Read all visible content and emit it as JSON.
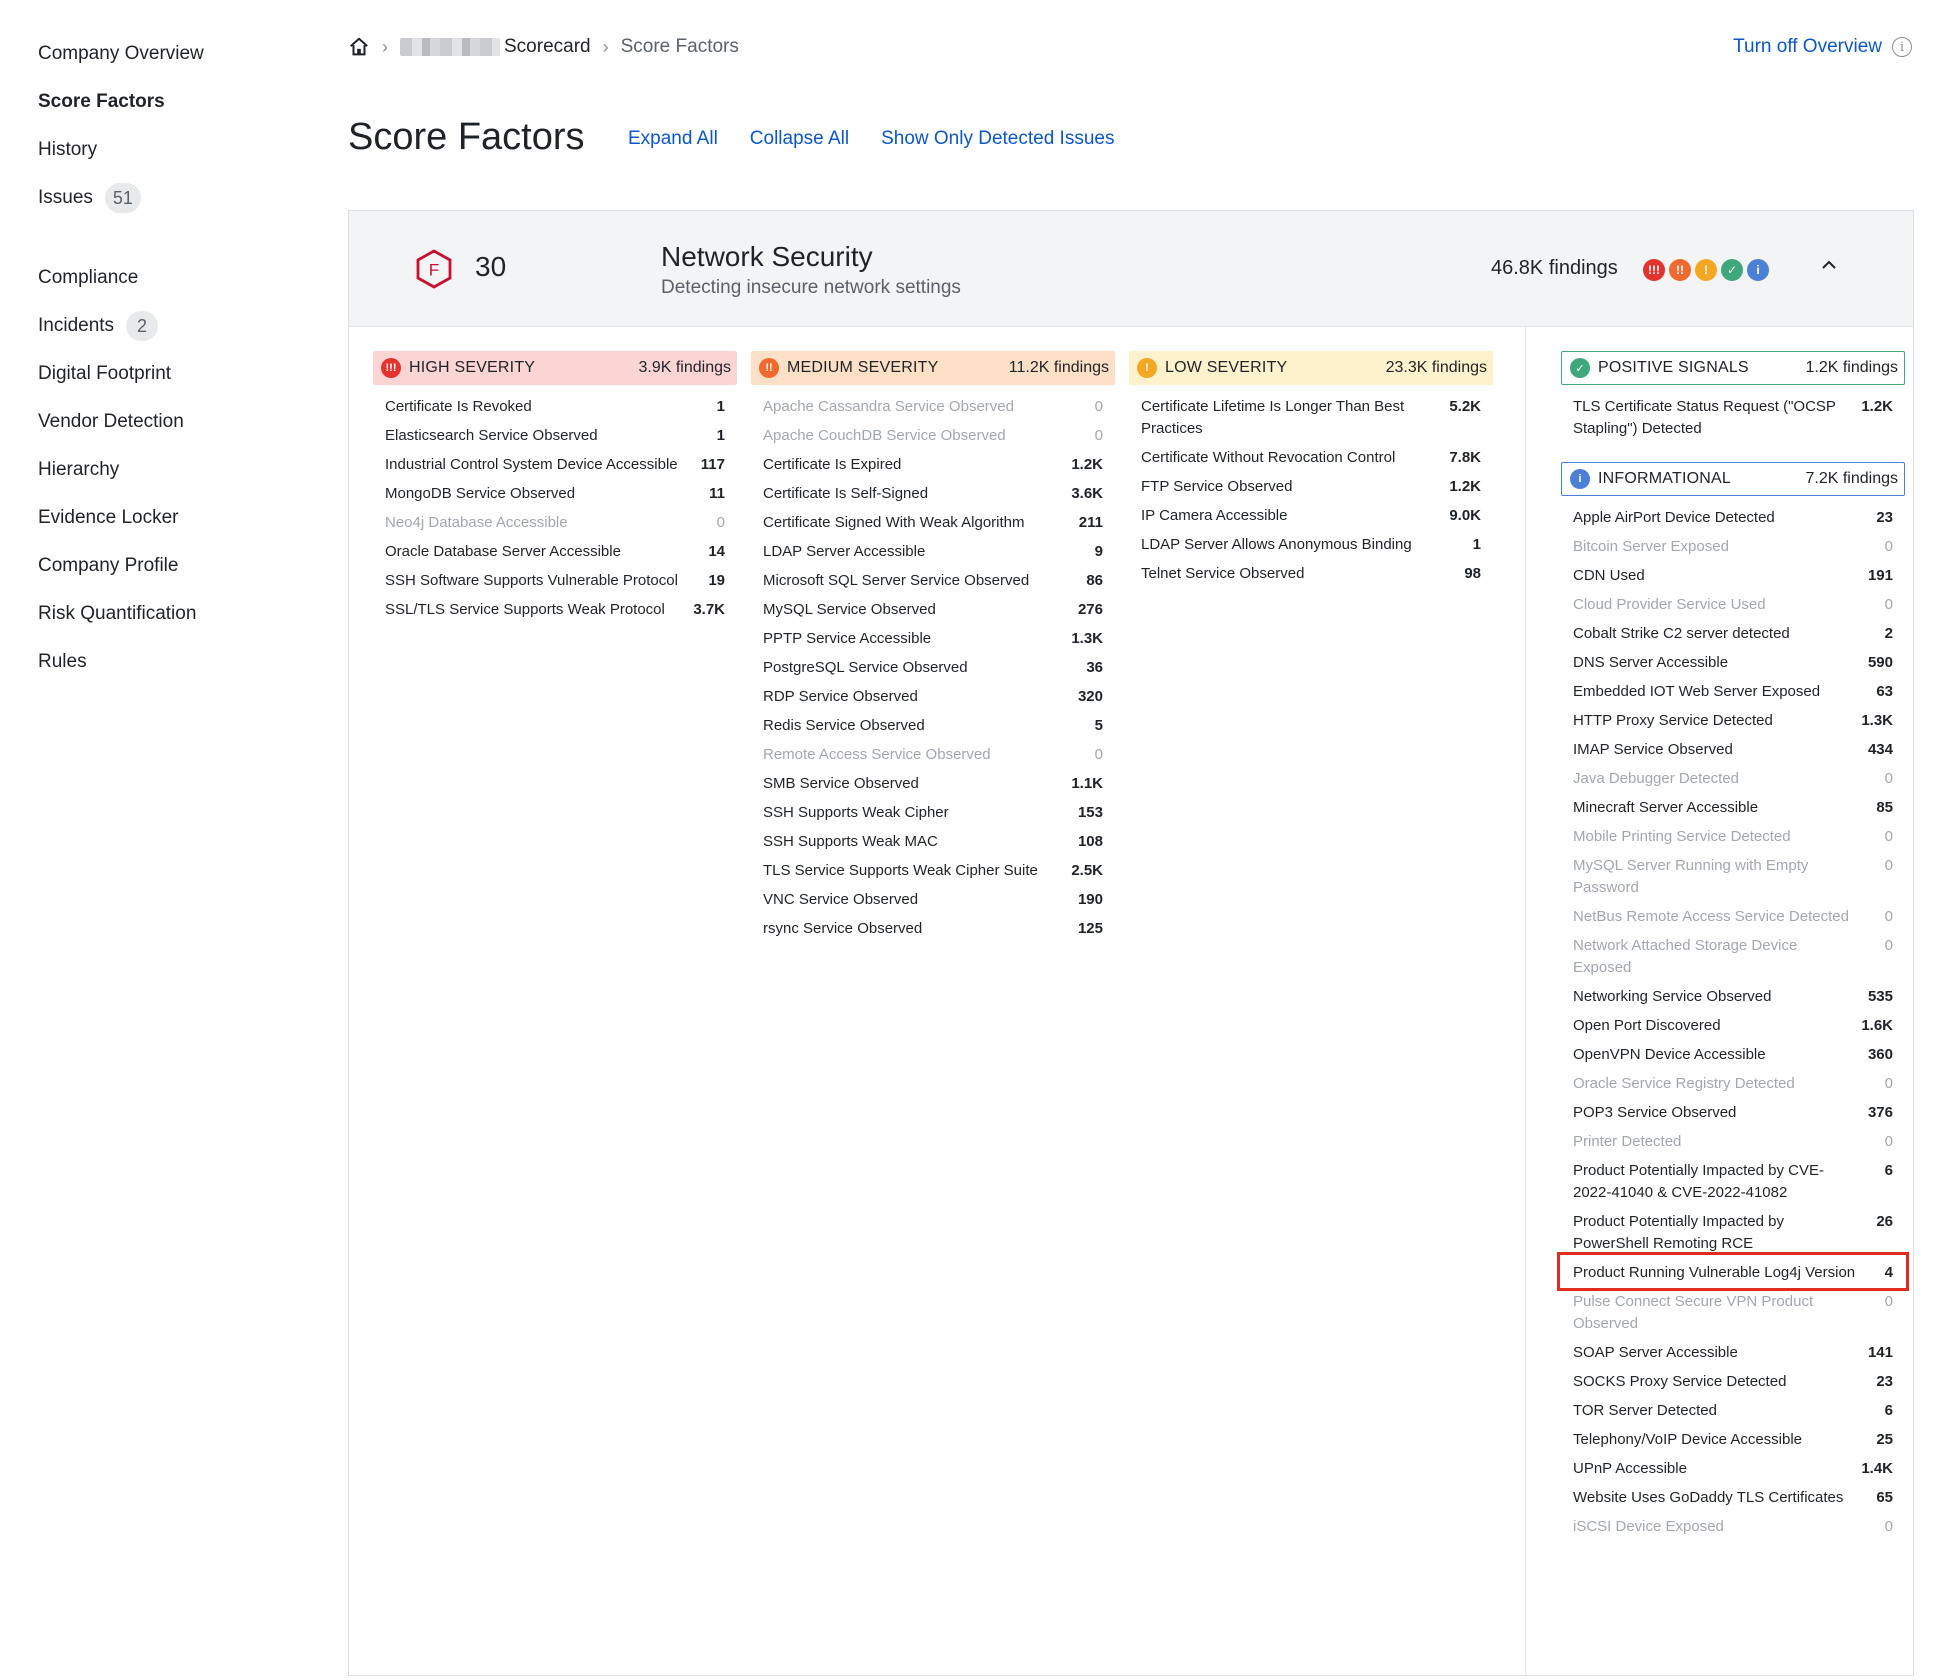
{
  "sidebar": {
    "items": [
      {
        "label": "Company Overview"
      },
      {
        "label": "Score Factors",
        "active": true
      },
      {
        "label": "History"
      },
      {
        "label": "Issues",
        "badge": "51"
      },
      {
        "label": "Compliance"
      },
      {
        "label": "Incidents",
        "badge": "2"
      },
      {
        "label": "Digital Footprint"
      },
      {
        "label": "Vendor Detection"
      },
      {
        "label": "Hierarchy"
      },
      {
        "label": "Evidence Locker"
      },
      {
        "label": "Company Profile"
      },
      {
        "label": "Risk Quantification"
      },
      {
        "label": "Rules"
      }
    ]
  },
  "breadcrumb": {
    "scorecard": "Scorecard",
    "current": "Score Factors"
  },
  "header": {
    "turn_off": "Turn off Overview",
    "title": "Score Factors",
    "expand_all": "Expand All",
    "collapse_all": "Collapse All",
    "show_detected": "Show Only Detected Issues"
  },
  "category": {
    "grade": "F",
    "score": "30",
    "title": "Network Security",
    "subtitle": "Detecting insecure network settings",
    "findings": "46.8K findings"
  },
  "colors": {
    "high": "#e5322d",
    "medium": "#f06a2f",
    "low": "#f5a623",
    "positive": "#3ea87a",
    "info": "#4c7fd6",
    "grade": "#c8102e",
    "link": "#0b57c9"
  },
  "high": {
    "label": "HIGH SEVERITY",
    "findings": "3.9K findings",
    "rows": [
      {
        "name": "Certificate Is Revoked",
        "value": "1"
      },
      {
        "name": "Elasticsearch Service Observed",
        "value": "1"
      },
      {
        "name": "Industrial Control System Device Accessible",
        "value": "117"
      },
      {
        "name": "MongoDB Service Observed",
        "value": "11"
      },
      {
        "name": "Neo4j Database Accessible",
        "value": "0"
      },
      {
        "name": "Oracle Database Server Accessible",
        "value": "14"
      },
      {
        "name": "SSH Software Supports Vulnerable Protocol",
        "value": "19"
      },
      {
        "name": "SSL/TLS Service Supports Weak Protocol",
        "value": "3.7K"
      }
    ]
  },
  "medium": {
    "label": "MEDIUM SEVERITY",
    "findings": "11.2K findings",
    "rows": [
      {
        "name": "Apache Cassandra Service Observed",
        "value": "0"
      },
      {
        "name": "Apache CouchDB Service Observed",
        "value": "0"
      },
      {
        "name": "Certificate Is Expired",
        "value": "1.2K"
      },
      {
        "name": "Certificate Is Self-Signed",
        "value": "3.6K"
      },
      {
        "name": "Certificate Signed With Weak Algorithm",
        "value": "211"
      },
      {
        "name": "LDAP Server Accessible",
        "value": "9"
      },
      {
        "name": "Microsoft SQL Server Service Observed",
        "value": "86"
      },
      {
        "name": "MySQL Service Observed",
        "value": "276"
      },
      {
        "name": "PPTP Service Accessible",
        "value": "1.3K"
      },
      {
        "name": "PostgreSQL Service Observed",
        "value": "36"
      },
      {
        "name": "RDP Service Observed",
        "value": "320"
      },
      {
        "name": "Redis Service Observed",
        "value": "5"
      },
      {
        "name": "Remote Access Service Observed",
        "value": "0"
      },
      {
        "name": "SMB Service Observed",
        "value": "1.1K"
      },
      {
        "name": "SSH Supports Weak Cipher",
        "value": "153"
      },
      {
        "name": "SSH Supports Weak MAC",
        "value": "108"
      },
      {
        "name": "TLS Service Supports Weak Cipher Suite",
        "value": "2.5K"
      },
      {
        "name": "VNC Service Observed",
        "value": "190"
      },
      {
        "name": "rsync Service Observed",
        "value": "125"
      }
    ]
  },
  "low": {
    "label": "LOW SEVERITY",
    "findings": "23.3K findings",
    "rows": [
      {
        "name": "Certificate Lifetime Is Longer Than Best Practices",
        "value": "5.2K"
      },
      {
        "name": "Certificate Without Revocation Control",
        "value": "7.8K"
      },
      {
        "name": "FTP Service Observed",
        "value": "1.2K"
      },
      {
        "name": "IP Camera Accessible",
        "value": "9.0K"
      },
      {
        "name": "LDAP Server Allows Anonymous Binding",
        "value": "1"
      },
      {
        "name": "Telnet Service Observed",
        "value": "98"
      }
    ]
  },
  "positive": {
    "label": "POSITIVE SIGNALS",
    "findings": "1.2K findings",
    "rows": [
      {
        "name": "TLS Certificate Status Request (\"OCSP Stapling\") Detected",
        "value": "1.2K"
      }
    ]
  },
  "info": {
    "label": "INFORMATIONAL",
    "findings": "7.2K findings",
    "rows": [
      {
        "name": "Apple AirPort Device Detected",
        "value": "23"
      },
      {
        "name": "Bitcoin Server Exposed",
        "value": "0"
      },
      {
        "name": "CDN Used",
        "value": "191"
      },
      {
        "name": "Cloud Provider Service Used",
        "value": "0"
      },
      {
        "name": "Cobalt Strike C2 server detected",
        "value": "2"
      },
      {
        "name": "DNS Server Accessible",
        "value": "590"
      },
      {
        "name": "Embedded IOT Web Server Exposed",
        "value": "63"
      },
      {
        "name": "HTTP Proxy Service Detected",
        "value": "1.3K"
      },
      {
        "name": "IMAP Service Observed",
        "value": "434"
      },
      {
        "name": "Java Debugger Detected",
        "value": "0"
      },
      {
        "name": "Minecraft Server Accessible",
        "value": "85"
      },
      {
        "name": "Mobile Printing Service Detected",
        "value": "0"
      },
      {
        "name": "MySQL Server Running with Empty Password",
        "value": "0"
      },
      {
        "name": "NetBus Remote Access Service Detected",
        "value": "0"
      },
      {
        "name": "Network Attached Storage Device Exposed",
        "value": "0"
      },
      {
        "name": "Networking Service Observed",
        "value": "535"
      },
      {
        "name": "Open Port Discovered",
        "value": "1.6K"
      },
      {
        "name": "OpenVPN Device Accessible",
        "value": "360"
      },
      {
        "name": "Oracle Service Registry Detected",
        "value": "0"
      },
      {
        "name": "POP3 Service Observed",
        "value": "376"
      },
      {
        "name": "Printer Detected",
        "value": "0"
      },
      {
        "name": "Product Potentially Impacted by CVE-2022-41040 & CVE-2022-41082",
        "value": "6"
      },
      {
        "name": "Product Potentially Impacted by PowerShell Remoting RCE",
        "value": "26"
      },
      {
        "name": "Product Running Vulnerable Log4j Version",
        "value": "4",
        "highlighted": true
      },
      {
        "name": "Pulse Connect Secure VPN Product Observed",
        "value": "0"
      },
      {
        "name": "SOAP Server Accessible",
        "value": "141"
      },
      {
        "name": "SOCKS Proxy Service Detected",
        "value": "23"
      },
      {
        "name": "TOR Server Detected",
        "value": "6"
      },
      {
        "name": "Telephony/VoIP Device Accessible",
        "value": "25"
      },
      {
        "name": "UPnP Accessible",
        "value": "1.4K"
      },
      {
        "name": "Website Uses GoDaddy TLS Certificates",
        "value": "65"
      },
      {
        "name": "iSCSI Device Exposed",
        "value": "0"
      }
    ]
  }
}
